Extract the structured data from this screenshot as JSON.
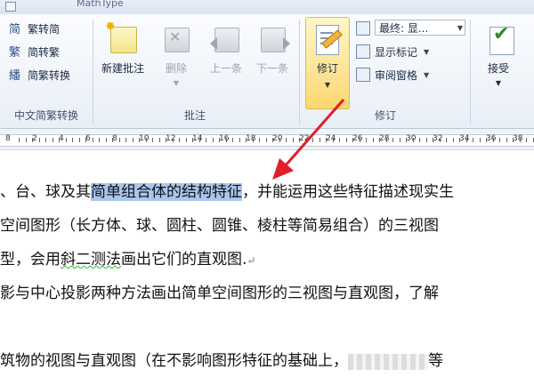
{
  "window": {
    "tab_fragment": "MathType"
  },
  "ribbon": {
    "chinese_group": {
      "label": "中文简繁转换",
      "items": [
        {
          "label": "繁转简",
          "icon": "traditional-to-simplified-icon"
        },
        {
          "label": "简转繁",
          "icon": "simplified-to-traditional-icon"
        },
        {
          "label": "简繁转换",
          "icon": "conversion-icon"
        }
      ]
    },
    "comments_group": {
      "label": "批注",
      "new_comment": "新建批注",
      "delete": "删除",
      "previous": "上一条",
      "next": "下一条"
    },
    "tracking_group": {
      "label": "修订",
      "track_changes": "修订",
      "final_combo": "最终: 显...",
      "show_markup": "显示标记",
      "review_pane": "审阅窗格"
    },
    "changes_group": {
      "accept": "接受"
    }
  },
  "ruler": {
    "numbers": [
      "8",
      "2",
      "4",
      "6",
      "8",
      "10",
      "12",
      "14",
      "16",
      "18",
      "20",
      "22",
      "24",
      "26",
      "28",
      "30",
      "32",
      "34",
      "36",
      "38"
    ]
  },
  "document": {
    "line1": {
      "prefix": "、台、球及其",
      "selected": "简单组合体的结构特征",
      "suffix": "，并能运用这些特征描述现实生"
    },
    "line2": "空间图形（长方体、球、圆柱、圆锥、棱柱等简易组合）的三视图",
    "line3": {
      "text1": "型，会用",
      "wavy": "斜二测法",
      "text2": "画出它们的直观图.",
      "mark": "↵"
    },
    "line4": "影与中心投影两种方法画出简单空间图形的三视图与直观图，了解",
    "line5": {
      "text": "筑物的视图与直观图（在不影响图形特征的基础上，",
      "tail": "等"
    }
  },
  "colors": {
    "highlight": "#a9c6ef",
    "arrow": "#e11d2a",
    "track_active": "#fbd770"
  }
}
